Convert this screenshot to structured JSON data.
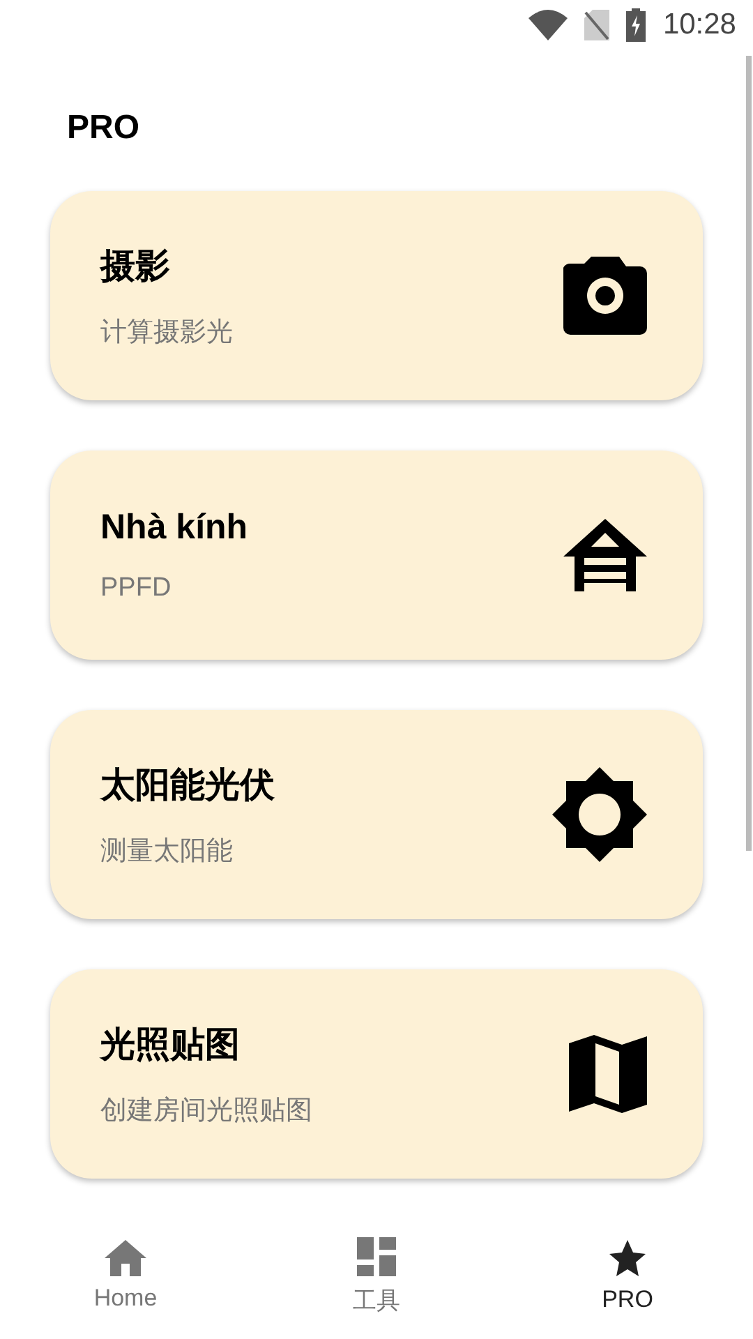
{
  "status_bar": {
    "time": "10:28"
  },
  "title": "PRO",
  "cards": [
    {
      "kind": "camera",
      "title": "摄影",
      "subtitle": "计算摄影光"
    },
    {
      "kind": "greenhouse",
      "title": "Nhà kính",
      "subtitle": "PPFD"
    },
    {
      "kind": "sun",
      "title": "太阳能光伏",
      "subtitle": "测量太阳能"
    },
    {
      "kind": "map",
      "title": "光照贴图",
      "subtitle": "创建房间光照贴图"
    }
  ],
  "nav": [
    {
      "kind": "home",
      "label": "Home",
      "selected": false
    },
    {
      "kind": "grid",
      "label": "工具",
      "selected": false
    },
    {
      "kind": "pro",
      "label": "PRO",
      "selected": true
    }
  ]
}
